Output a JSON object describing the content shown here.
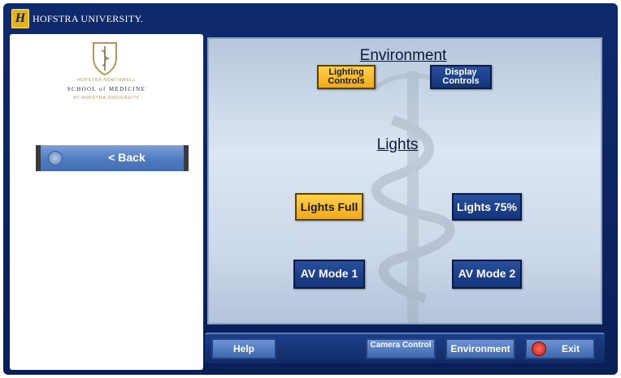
{
  "app": {
    "brand": "HOFSTRA UNIVERSITY."
  },
  "school": {
    "line1": "HOFSTRA NORTHWELL",
    "line2": "SCHOOL of MEDICINE",
    "line3": "AT HOFSTRA UNIVERSITY"
  },
  "nav": {
    "back_label": "< Back"
  },
  "main": {
    "environment_heading": "Environment",
    "tabs": [
      {
        "label": "Lighting Controls",
        "active": true
      },
      {
        "label": "Display Controls",
        "active": false
      }
    ],
    "lights_heading": "Lights",
    "buttons": [
      {
        "label": "Lights Full",
        "active": true
      },
      {
        "label": "Lights 75%",
        "active": false
      },
      {
        "label": "AV Mode 1",
        "active": false
      },
      {
        "label": "AV Mode 2",
        "active": false
      }
    ]
  },
  "bottom": {
    "help": "Help",
    "camera": "Camera Control",
    "environment": "Environment",
    "exit": "Exit"
  },
  "colors": {
    "frame": "#0e2a6e",
    "active_button": "#f5b820",
    "inactive_button": "#1e4290"
  },
  "icons": [
    "home-icon",
    "power-icon",
    "caduceus-icon",
    "crest-icon",
    "hofstra-logo-icon"
  ]
}
